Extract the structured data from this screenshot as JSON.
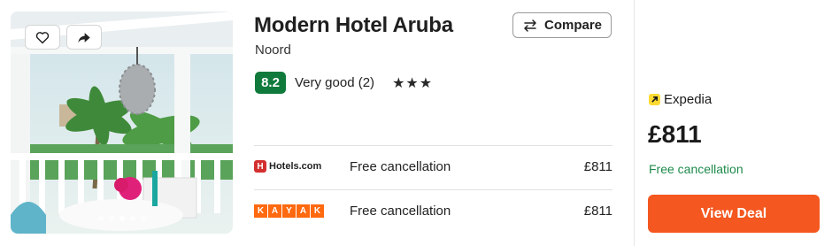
{
  "hotel": {
    "name": "Modern Hotel Aruba",
    "location": "Noord",
    "score": "8.2",
    "rating_text": "Very good (2)",
    "stars": "★★★"
  },
  "actions": {
    "compare_label": "Compare",
    "view_deal_label": "View Deal",
    "favorite_icon": "heart-icon",
    "share_icon": "share-arrow-icon"
  },
  "gallery": {
    "dot_count": 5,
    "active_dot": 2
  },
  "offers": [
    {
      "provider": "Hotels.com",
      "cancellation": "Free cancellation",
      "price": "£811"
    },
    {
      "provider": "KAYAK",
      "cancellation": "Free cancellation",
      "price": "£811"
    }
  ],
  "best_offer": {
    "provider": "Expedia",
    "price": "£811",
    "cancellation": "Free cancellation"
  },
  "colors": {
    "score_bg": "#0f7a3b",
    "deal_button": "#f4571f",
    "free_cancel_text": "#1e8a4b",
    "kayak_orange": "#ff690f",
    "expedia_yellow": "#fddb32"
  }
}
